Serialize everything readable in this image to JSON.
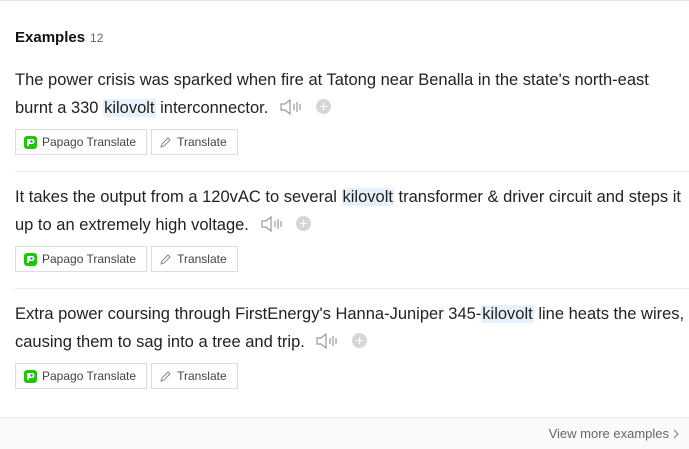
{
  "header": {
    "title": "Examples",
    "count": "12"
  },
  "examples": [
    {
      "before": "The power crisis was sparked when fire at Tatong near Benalla in the state's north-east burnt a 330 ",
      "highlight": "kilovolt",
      "after": " interconnector."
    },
    {
      "before": "It takes the output from a 120vAC to several ",
      "highlight": "kilovolt",
      "after": " transformer & driver circuit and steps it up to an extremely high voltage."
    },
    {
      "before": "Extra power coursing through FirstEnergy's Hanna-Juniper 345-",
      "highlight": "kilovolt",
      "after": " line heats the wires, causing them to sag into a tree and trip."
    }
  ],
  "buttons": {
    "papago": "Papago Translate",
    "translate": "Translate"
  },
  "footer": {
    "view_more": "View more examples"
  },
  "icons": {
    "speaker": "speaker-icon",
    "plus": "add-icon",
    "papago": "papago-logo-icon",
    "pencil": "pencil-icon",
    "chevron": "chevron-right-icon"
  },
  "colors": {
    "highlight": "#e7f1fb",
    "papago_green": "#1ec800",
    "papago_blue": "#1a73e8"
  }
}
